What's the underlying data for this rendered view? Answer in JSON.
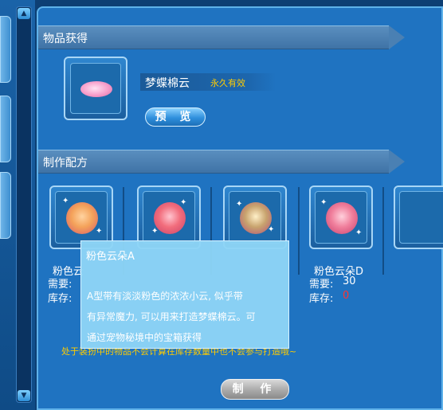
{
  "section_obtain": {
    "title": "物品获得"
  },
  "product": {
    "name": "梦蝶棉云",
    "duration": "永久有效",
    "preview_label": "预 览",
    "icon": "pink-cloud-icon"
  },
  "section_recipe": {
    "title": "制作配方"
  },
  "materials": [
    {
      "name": "粉色云",
      "need_label": "需要:",
      "stock_label": "库存:",
      "icon": "orange-cloud-orb-icon",
      "color": "#f4a25a"
    },
    {
      "name": "",
      "need_label": "",
      "stock_label": "",
      "icon": "red-cloud-orb-icon",
      "color": "#f26d7c"
    },
    {
      "name": "",
      "need_label": "",
      "stock_label": "",
      "icon": "green-pink-cloud-orb-icon",
      "color": "#c8a36e"
    },
    {
      "name": "粉色云朵D",
      "need_label": "需要:",
      "need_value": "30",
      "stock_label": "库存:",
      "stock_value": "0",
      "icon": "pink-cloud-orb-icon",
      "color": "#f07f9c"
    }
  ],
  "notice": "处于装扮中的物品不会计算在库存数量中也不会参与打造哦~",
  "make_label": "制 作",
  "tooltip": {
    "title": "粉色云朵A",
    "lines": [
      "A型带有淡淡粉色的浓浓小云, 似乎带",
      "有异常魔力, 可以用来打造梦蝶棉云。可",
      "通过宠物秘境中的宝箱获得"
    ]
  },
  "colors": {
    "panel": "#1f73c1",
    "accent_gold": "#ffcc00",
    "stock_zero": "#ff3333"
  }
}
